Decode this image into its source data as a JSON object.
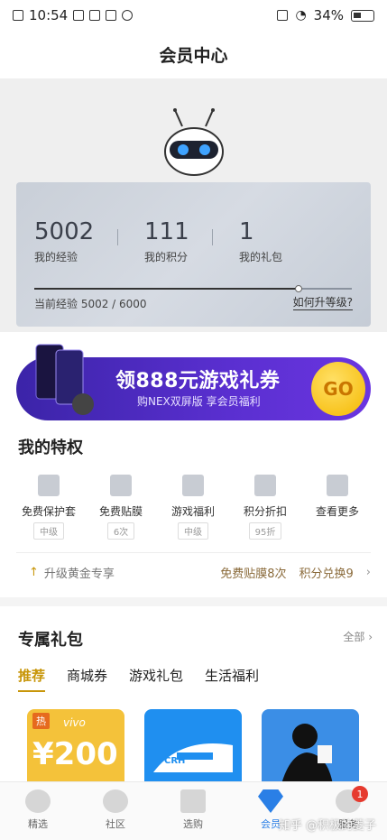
{
  "status_bar": {
    "time": "10:54",
    "battery": "34%"
  },
  "header": {
    "title": "会员中心"
  },
  "member_card": {
    "stats": [
      {
        "value": "5002",
        "label": "我的经验"
      },
      {
        "value": "111",
        "label": "我的积分"
      },
      {
        "value": "1",
        "label": "我的礼包"
      }
    ],
    "progress_fraction": 0.8337,
    "exp_text": "当前经验 5002 / 6000",
    "how_to_upgrade": "如何升等级?"
  },
  "banner": {
    "title": "领888元游戏礼券",
    "subtitle": "购NEX双屏版 享会员福利",
    "go_label": "GO"
  },
  "privileges": {
    "title": "我的特权",
    "items": [
      {
        "name": "免费保护套",
        "tag": "中级",
        "icon": "phone-case-icon"
      },
      {
        "name": "免费贴膜",
        "tag": "6次",
        "icon": "screen-film-icon"
      },
      {
        "name": "游戏福利",
        "tag": "中级",
        "icon": "gamepad-icon"
      },
      {
        "name": "积分折扣",
        "tag": "95折",
        "icon": "discount-icon"
      },
      {
        "name": "查看更多",
        "tag": "",
        "icon": "more-icon"
      }
    ],
    "upgrade_text": "升级黄金专享",
    "right_1": "免费贴膜8次",
    "right_2": "积分兑换9"
  },
  "gifts": {
    "title": "专属礼包",
    "see_all": "全部",
    "tabs": [
      "推荐",
      "商城券",
      "游戏礼包",
      "生活福利"
    ],
    "card_1": {
      "badge": "热",
      "brand": "vivo",
      "amount": "¥200"
    },
    "card_2": {
      "brand": "CRH"
    }
  },
  "bottom_nav": {
    "items": [
      "精选",
      "社区",
      "选购",
      "会员",
      "服务"
    ],
    "active": "会员",
    "service_badge": "1"
  },
  "watermark": "知乎 @积极的菱子",
  "colors": {
    "accent_gold": "#c8960a",
    "active_blue": "#2a7fe6",
    "banner_purple": "#4a2ac0"
  }
}
